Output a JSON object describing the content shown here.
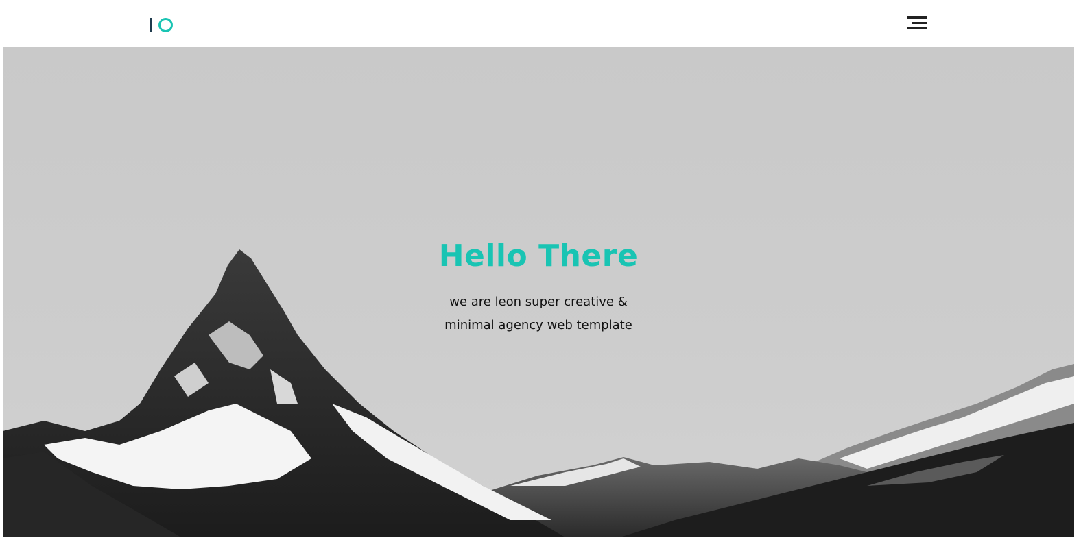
{
  "colors": {
    "accent": "#19c4b3",
    "dark": "#1f3b4d"
  },
  "header": {
    "logo_icon": "io-logo",
    "menu_icon": "hamburger-menu-icon"
  },
  "hero": {
    "title": "Hello There",
    "subtitle_line1": "we are leon super creative &",
    "subtitle_line2": "minimal agency web template",
    "background": "black-and-white mountain landscape"
  }
}
